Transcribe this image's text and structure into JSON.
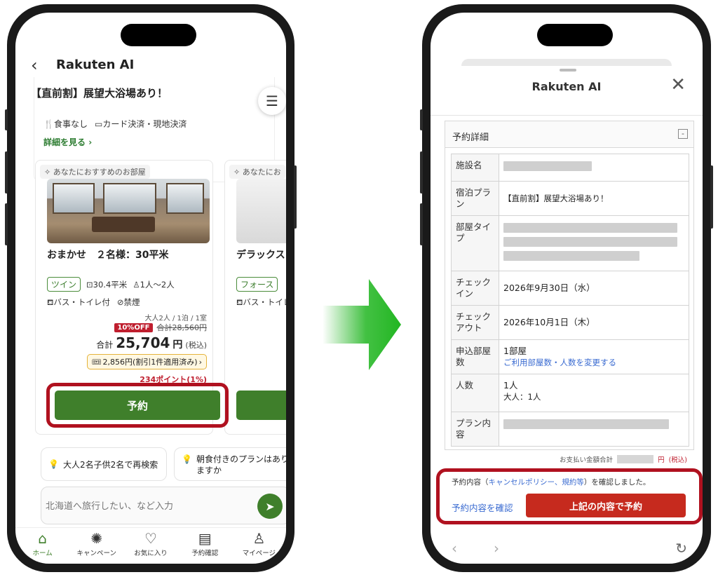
{
  "left": {
    "header_title": "Rakuten AI",
    "plan_title": "【直前割】展望大浴場あり！",
    "attributes": [
      "食事なし",
      "カード決済・現地決済"
    ],
    "detail_link": "詳細を見る",
    "rec_tag": "あなたにおすすめのお部屋",
    "room": {
      "name": "おまかせ　２名様：30平米",
      "type_badge": "ツイン",
      "size": "30.4平米",
      "capacity": "1人〜2人",
      "bath": "バス・トイレ付",
      "smoking": "禁煙",
      "guests_line": "大人2人 / 1泊 / 1室",
      "off_badge": "10%OFF",
      "original_price": "合計28,560円",
      "total_label": "合計",
      "total_price": "25,704",
      "total_unit": "円",
      "tax": "(税込)",
      "coupon": "2,856円(割引1件適用済み)",
      "points": "234ポイント(1%)",
      "reserve_label": "予約"
    },
    "room2": {
      "rec_tag": "あなたにお",
      "name": "デラックス",
      "type_badge": "フォース",
      "bath": "バス・トイレ"
    },
    "suggestions": [
      "大人2名子供2名で再検索",
      "朝食付きのプランはありますか"
    ],
    "chat_placeholder": "北海道へ旅行したい、など入力",
    "tabs": [
      "ホーム",
      "キャンペーン",
      "お気に入り",
      "予約確認",
      "マイページ"
    ]
  },
  "right": {
    "header_title": "Rakuten AI",
    "details_label": "予約詳細",
    "collapse_symbol": "-",
    "rows": {
      "facility_key": "施設名",
      "plan_key": "宿泊プラン",
      "plan_value": "【直前割】展望大浴場あり！",
      "room_type_key": "部屋タイプ",
      "checkin_key": "チェックイン",
      "checkin_value": "2026年9月30日（水）",
      "checkout_key": "チェックアウト",
      "checkout_value": "2026年10月1日（木）",
      "rooms_key": "申込部屋数",
      "rooms_value": "1部屋",
      "rooms_link": "ご利用部屋数・人数を変更する",
      "people_key": "人数",
      "people_value": "1人",
      "people_sub": "大人：1人",
      "plan_content_key": "プラン内容"
    },
    "pay_total_label": "お支払い金額合計",
    "pay_total_unit": "円",
    "pay_total_tax": "(税込)",
    "confirm_prefix": "予約内容（",
    "confirm_link": "キャンセルポリシー、規約等",
    "confirm_suffix": "）を確認しました。",
    "check_link": "予約内容を確認",
    "book_label": "上記の内容で予約"
  },
  "colors": {
    "rakuten_green": "#3f7f2b",
    "highlight_red": "#b0111f",
    "book_red": "#c62a1e",
    "link_blue": "#3a6bd1",
    "arrow_green": "#22b622"
  }
}
